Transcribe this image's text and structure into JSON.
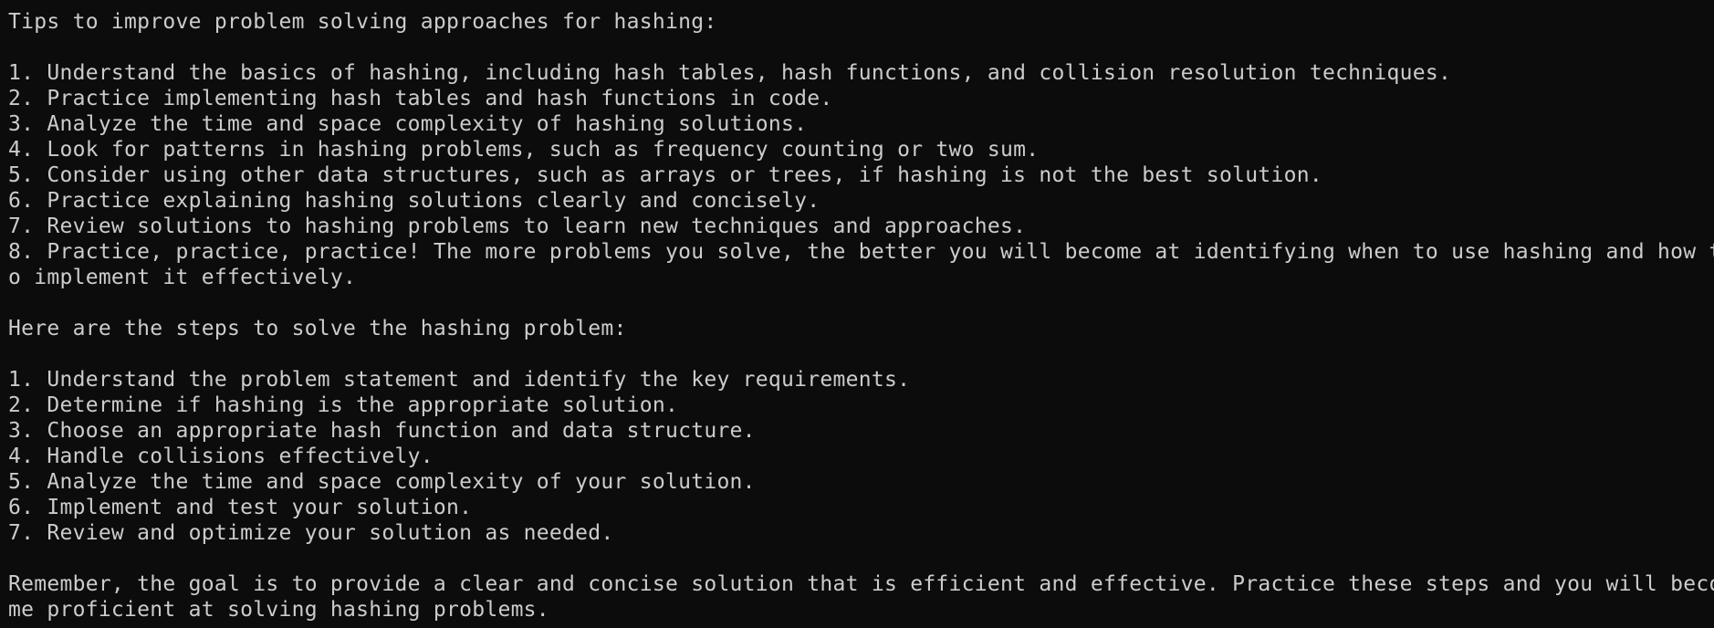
{
  "terminal": {
    "colors": {
      "background": "#0c0c0c",
      "foreground": "#cccccc"
    },
    "lines": [
      "Tips to improve problem solving approaches for hashing:",
      "",
      "1. Understand the basics of hashing, including hash tables, hash functions, and collision resolution techniques.",
      "2. Practice implementing hash tables and hash functions in code.",
      "3. Analyze the time and space complexity of hashing solutions.",
      "4. Look for patterns in hashing problems, such as frequency counting or two sum.",
      "5. Consider using other data structures, such as arrays or trees, if hashing is not the best solution.",
      "6. Practice explaining hashing solutions clearly and concisely.",
      "7. Review solutions to hashing problems to learn new techniques and approaches.",
      "8. Practice, practice, practice! The more problems you solve, the better you will become at identifying when to use hashing and how t",
      "o implement it effectively.",
      "",
      "Here are the steps to solve the hashing problem:",
      "",
      "1. Understand the problem statement and identify the key requirements.",
      "2. Determine if hashing is the appropriate solution.",
      "3. Choose an appropriate hash function and data structure.",
      "4. Handle collisions effectively.",
      "5. Analyze the time and space complexity of your solution.",
      "6. Implement and test your solution.",
      "7. Review and optimize your solution as needed.",
      "",
      "Remember, the goal is to provide a clear and concise solution that is efficient and effective. Practice these steps and you will beco",
      "me proficient at solving hashing problems."
    ]
  }
}
